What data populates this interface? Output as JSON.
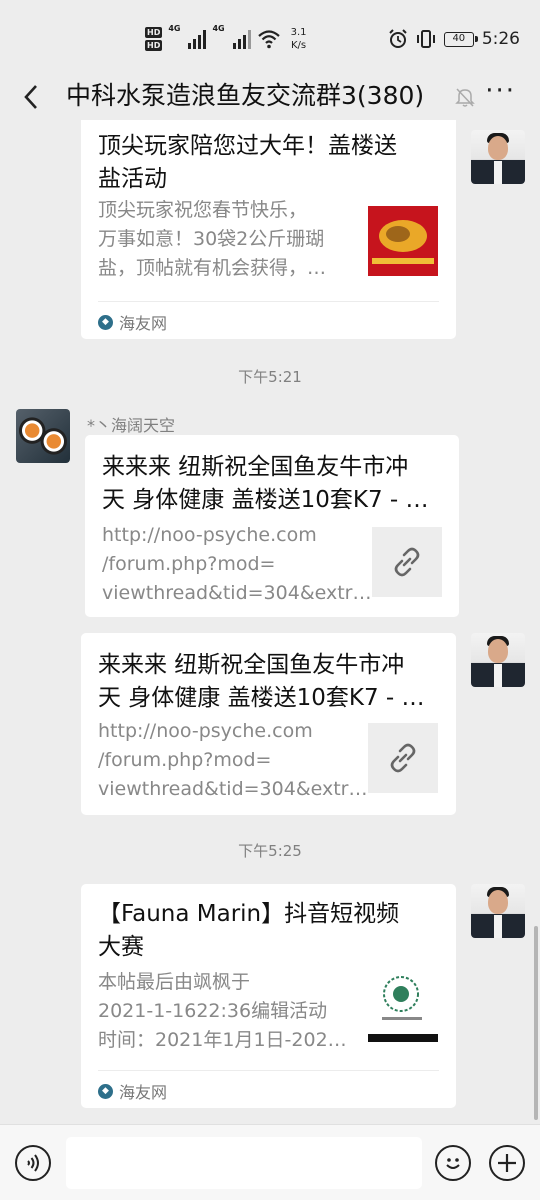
{
  "status_bar": {
    "hd1": "HD",
    "hd2": "HD",
    "net1": "4G",
    "net2": "4G",
    "speed_value": "3.1",
    "speed_unit": "K/s",
    "battery": "40",
    "time": "5:26"
  },
  "header": {
    "title": "中科水泵造浪鱼友交流群3(380)"
  },
  "messages": {
    "m1": {
      "title_line1": "顶尖玩家陪您过大年！盖楼送",
      "title_line2": "盐活动",
      "desc_line1": "顶尖玩家祝您春节快乐，",
      "desc_line2": "万事如意！30袋2公斤珊瑚",
      "desc_line3": "盐，顶帖就有机会获得，…",
      "source": "海友网"
    },
    "time1": "下午5:21",
    "m2": {
      "sender": "*丶海阔天空",
      "title_line1": "来来来 纽斯祝全国鱼友牛市冲",
      "title_line2": "天 身体健康 盖楼送10套K7 - …",
      "desc_line1": "http://noo-psyche.com",
      "desc_line2": "/forum.php?mod=",
      "desc_line3": "viewthread&tid=304&extr…"
    },
    "m3": {
      "title_line1": "来来来 纽斯祝全国鱼友牛市冲",
      "title_line2": "天 身体健康 盖楼送10套K7 - …",
      "desc_line1": "http://noo-psyche.com",
      "desc_line2": "/forum.php?mod=",
      "desc_line3": "viewthread&tid=304&extr…"
    },
    "time2": "下午5:25",
    "m4": {
      "title_line1": "【Fauna Marin】抖音短视频",
      "title_line2": "大赛",
      "desc_line1": "本帖最后由飒枫于",
      "desc_line2": "2021-1-1622:36编辑活动",
      "desc_line3": "时间：2021年1月1日-202…",
      "source": "海友网"
    }
  },
  "icons": {
    "back": "back-arrow-icon",
    "mute": "mute-bell-icon",
    "more": "more-dots-icon",
    "link": "link-icon",
    "voice": "voice-icon",
    "emoji": "emoji-icon",
    "plus": "plus-icon"
  },
  "colors": {
    "background": "#ededed",
    "card": "#ffffff",
    "source_logo": "#2e6f8a"
  }
}
